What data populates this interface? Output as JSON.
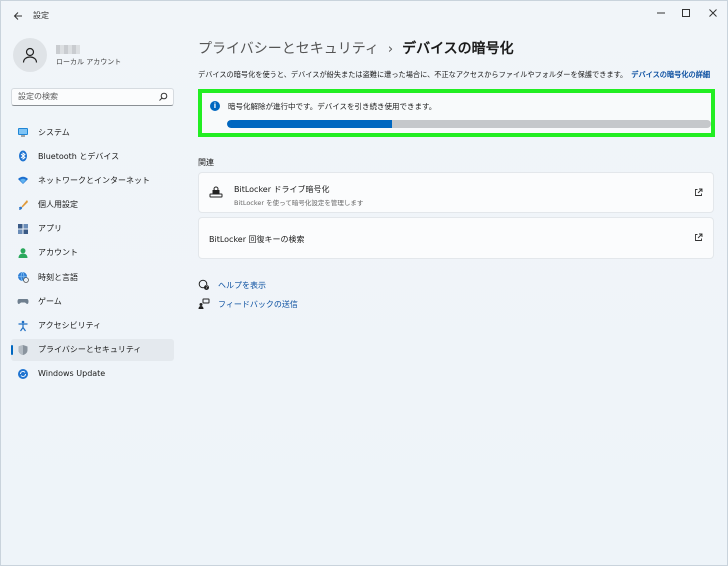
{
  "window": {
    "title": "設定"
  },
  "profile": {
    "account_type": "ローカル アカウント"
  },
  "search": {
    "placeholder": "設定の検索"
  },
  "nav": {
    "items": [
      {
        "label": "システム",
        "icon": "monitor-icon"
      },
      {
        "label": "Bluetooth とデバイス",
        "icon": "bluetooth-icon"
      },
      {
        "label": "ネットワークとインターネット",
        "icon": "wifi-icon"
      },
      {
        "label": "個人用設定",
        "icon": "brush-icon"
      },
      {
        "label": "アプリ",
        "icon": "apps-icon"
      },
      {
        "label": "アカウント",
        "icon": "person-icon"
      },
      {
        "label": "時刻と言語",
        "icon": "globe-clock-icon"
      },
      {
        "label": "ゲーム",
        "icon": "gamepad-icon"
      },
      {
        "label": "アクセシビリティ",
        "icon": "accessibility-icon"
      },
      {
        "label": "プライバシーとセキュリティ",
        "icon": "shield-icon",
        "selected": true
      },
      {
        "label": "Windows Update",
        "icon": "update-icon"
      }
    ]
  },
  "breadcrumb": {
    "parent": "プライバシーとセキュリティ",
    "separator": "›",
    "current": "デバイスの暗号化"
  },
  "description": {
    "text": "デバイスの暗号化を使うと、デバイスが紛失または盗難に遭った場合に、不正なアクセスからファイルやフォルダーを保護できます。",
    "link": "デバイスの暗号化の詳細"
  },
  "status": {
    "message": "暗号化解除が進行中です。デバイスを引き続き使用できます。",
    "progress_percent": 34,
    "highlight_color": "#22ee22"
  },
  "related": {
    "title": "関連",
    "bitlocker_title": "BitLocker ドライブ暗号化",
    "bitlocker_sub": "BitLocker を使って暗号化設定を管理します",
    "recovery_title": "BitLocker 回復キーの検索"
  },
  "help": {
    "help_label": "ヘルプを表示",
    "feedback_label": "フィードバックの送信"
  },
  "colors": {
    "accent": "#0067c0",
    "link": "#0b4fa0"
  }
}
